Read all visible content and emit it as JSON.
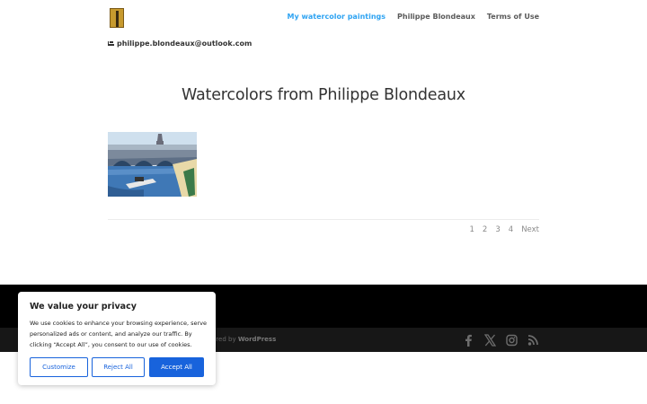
{
  "header": {
    "nav": [
      {
        "label": "My watercolor paintings",
        "active": true
      },
      {
        "label": "Philippe Blondeaux",
        "active": false
      },
      {
        "label": "Terms of Use",
        "active": false
      }
    ],
    "email": "philippe.blondeaux@outlook.com"
  },
  "main": {
    "title": "Watercolors from Philippe Blondeaux",
    "pagination": [
      "1",
      "2",
      "3",
      "4",
      "Next"
    ]
  },
  "footer": {
    "credit_prefix": "ered by",
    "credit_link": "WordPress",
    "social_icons": [
      "facebook-icon",
      "x-icon",
      "instagram-icon",
      "rss-icon"
    ]
  },
  "cookie": {
    "title": "We value your privacy",
    "text": "We use cookies to enhance your browsing experience, serve personalized ads or content, and analyze our traffic. By clicking “Accept All”, you consent to our use of cookies.",
    "customize": "Customize",
    "reject": "Reject All",
    "accept": "Accept All"
  },
  "colors": {
    "accent": "#2ea3f2",
    "cookie_button": "#1863dc",
    "footer_top": "#000000",
    "footer_bottom": "#171717"
  }
}
